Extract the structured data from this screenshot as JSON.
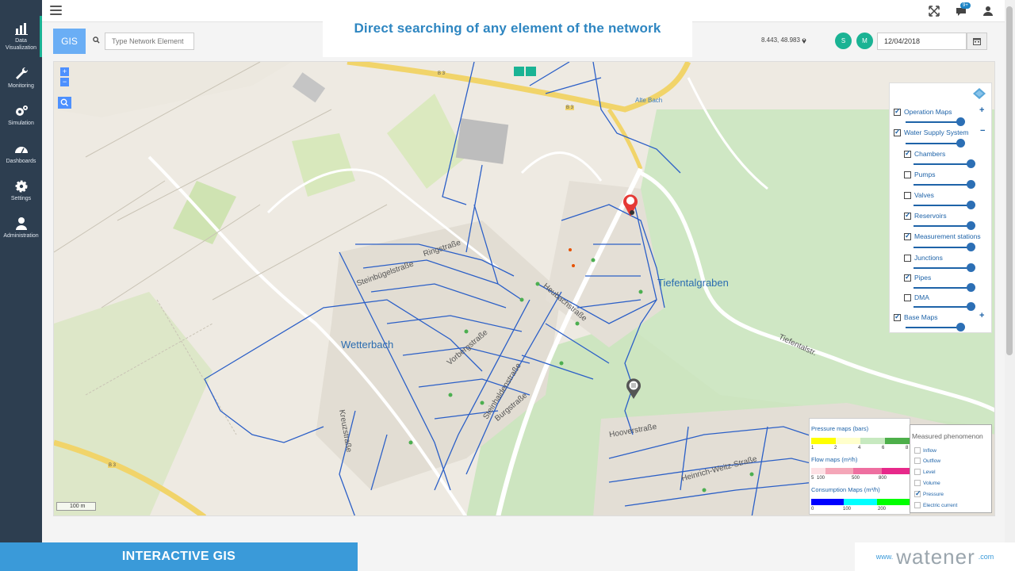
{
  "caption": "Direct searching of any element of the network",
  "sidebar": {
    "items": [
      {
        "label": "Data Visualization",
        "icon": "bar-chart-icon"
      },
      {
        "label": "Monitoring",
        "icon": "wrench-icon"
      },
      {
        "label": "Simulation",
        "icon": "gears-icon"
      },
      {
        "label": "Dashboards",
        "icon": "dashboard-gauge-icon"
      },
      {
        "label": "Settings",
        "icon": "gear-icon"
      },
      {
        "label": "Administration",
        "icon": "user-icon"
      }
    ]
  },
  "topbar": {
    "notification_count": "9+"
  },
  "toolbar": {
    "gis_label": "GIS",
    "search_placeholder": "Type Network Element",
    "coordinates": "8.443, 48.983",
    "s_label": "S",
    "m_label": "M",
    "date": "12/04/2018"
  },
  "map": {
    "labels": {
      "town": "Wetterbach",
      "stream": "Tiefentalgraben",
      "alte_bach": "Alte Bach",
      "ringstrasse": "Ringstraße",
      "steinbuegelstrasse": "Steinbügelstraße",
      "heubachstrasse": "Heubachstraße",
      "vorbergstrasse": "Vorbergstraße",
      "steinhaldenstrasse": "Steinhaldenstraße",
      "burgstrasse": "Burgstraße",
      "hooverstrasse": "Hooverstraße",
      "heinrich_weitz": "Heinrich-Weitz-Straße",
      "tiefentalstr": "Tiefentalstr.",
      "kreuzstrasse": "Kreuzstraße",
      "scale": "100 m",
      "b3_a": "B 3",
      "b3_b": "B 3",
      "b3_c": "B 3"
    }
  },
  "layers": {
    "groups": [
      {
        "label": "Operation Maps",
        "checked": true
      },
      {
        "label": "Water Supply System",
        "checked": true
      },
      {
        "label": "Chambers",
        "checked": true
      },
      {
        "label": "Pumps",
        "checked": false
      },
      {
        "label": "Valves",
        "checked": false
      },
      {
        "label": "Reservoirs",
        "checked": true
      },
      {
        "label": "Measurement stations",
        "checked": true
      },
      {
        "label": "Junctions",
        "checked": false
      },
      {
        "label": "Pipes",
        "checked": true
      },
      {
        "label": "DMA",
        "checked": false
      },
      {
        "label": "Base Maps",
        "checked": true
      }
    ]
  },
  "legend": {
    "pressure_title": "Pressure maps (bars)",
    "pressure_ticks": [
      "1",
      "2",
      "4",
      "6",
      "8"
    ],
    "flow_title": "Flow maps (m³/h)",
    "flow_ticks": [
      "5",
      "100",
      "500",
      "800"
    ],
    "consumption_title": "Consumption Maps (m³/h)",
    "consumption_ticks": [
      "0",
      "100",
      "200"
    ],
    "pressure_colors": [
      "#ffff00",
      "#ffff00",
      "#ffffcc",
      "#ffffcc",
      "#c7e9c0",
      "#c7e9c0",
      "#4daf4a",
      "#4daf4a"
    ],
    "flow_colors": [
      "#fde0e4",
      "#f4a6b8",
      "#f4a6b8",
      "#ee6fa0",
      "#ee6fa0",
      "#e7298a",
      "#e7298a"
    ],
    "consumption_colors": [
      "#0000ff",
      "#0000ff",
      "#00ffff",
      "#00ffff",
      "#00ff00",
      "#00ff00"
    ]
  },
  "phenomenon": {
    "title": "Measured phenomenon",
    "items": [
      {
        "label": "Inflow",
        "checked": false
      },
      {
        "label": "Outflow",
        "checked": false
      },
      {
        "label": "Level",
        "checked": false
      },
      {
        "label": "Volume",
        "checked": false
      },
      {
        "label": "Pressure",
        "checked": true
      },
      {
        "label": "Electric current",
        "checked": false
      }
    ]
  },
  "footer": {
    "banner": "INTERACTIVE GIS",
    "brand_prefix": "www.",
    "brand_name": "watener",
    "brand_suffix": ".com"
  },
  "colors": {
    "accent": "#1ab394",
    "primary": "#3a9ad9",
    "sidebar": "#2d3e50",
    "pipe": "#2b5fc7"
  }
}
